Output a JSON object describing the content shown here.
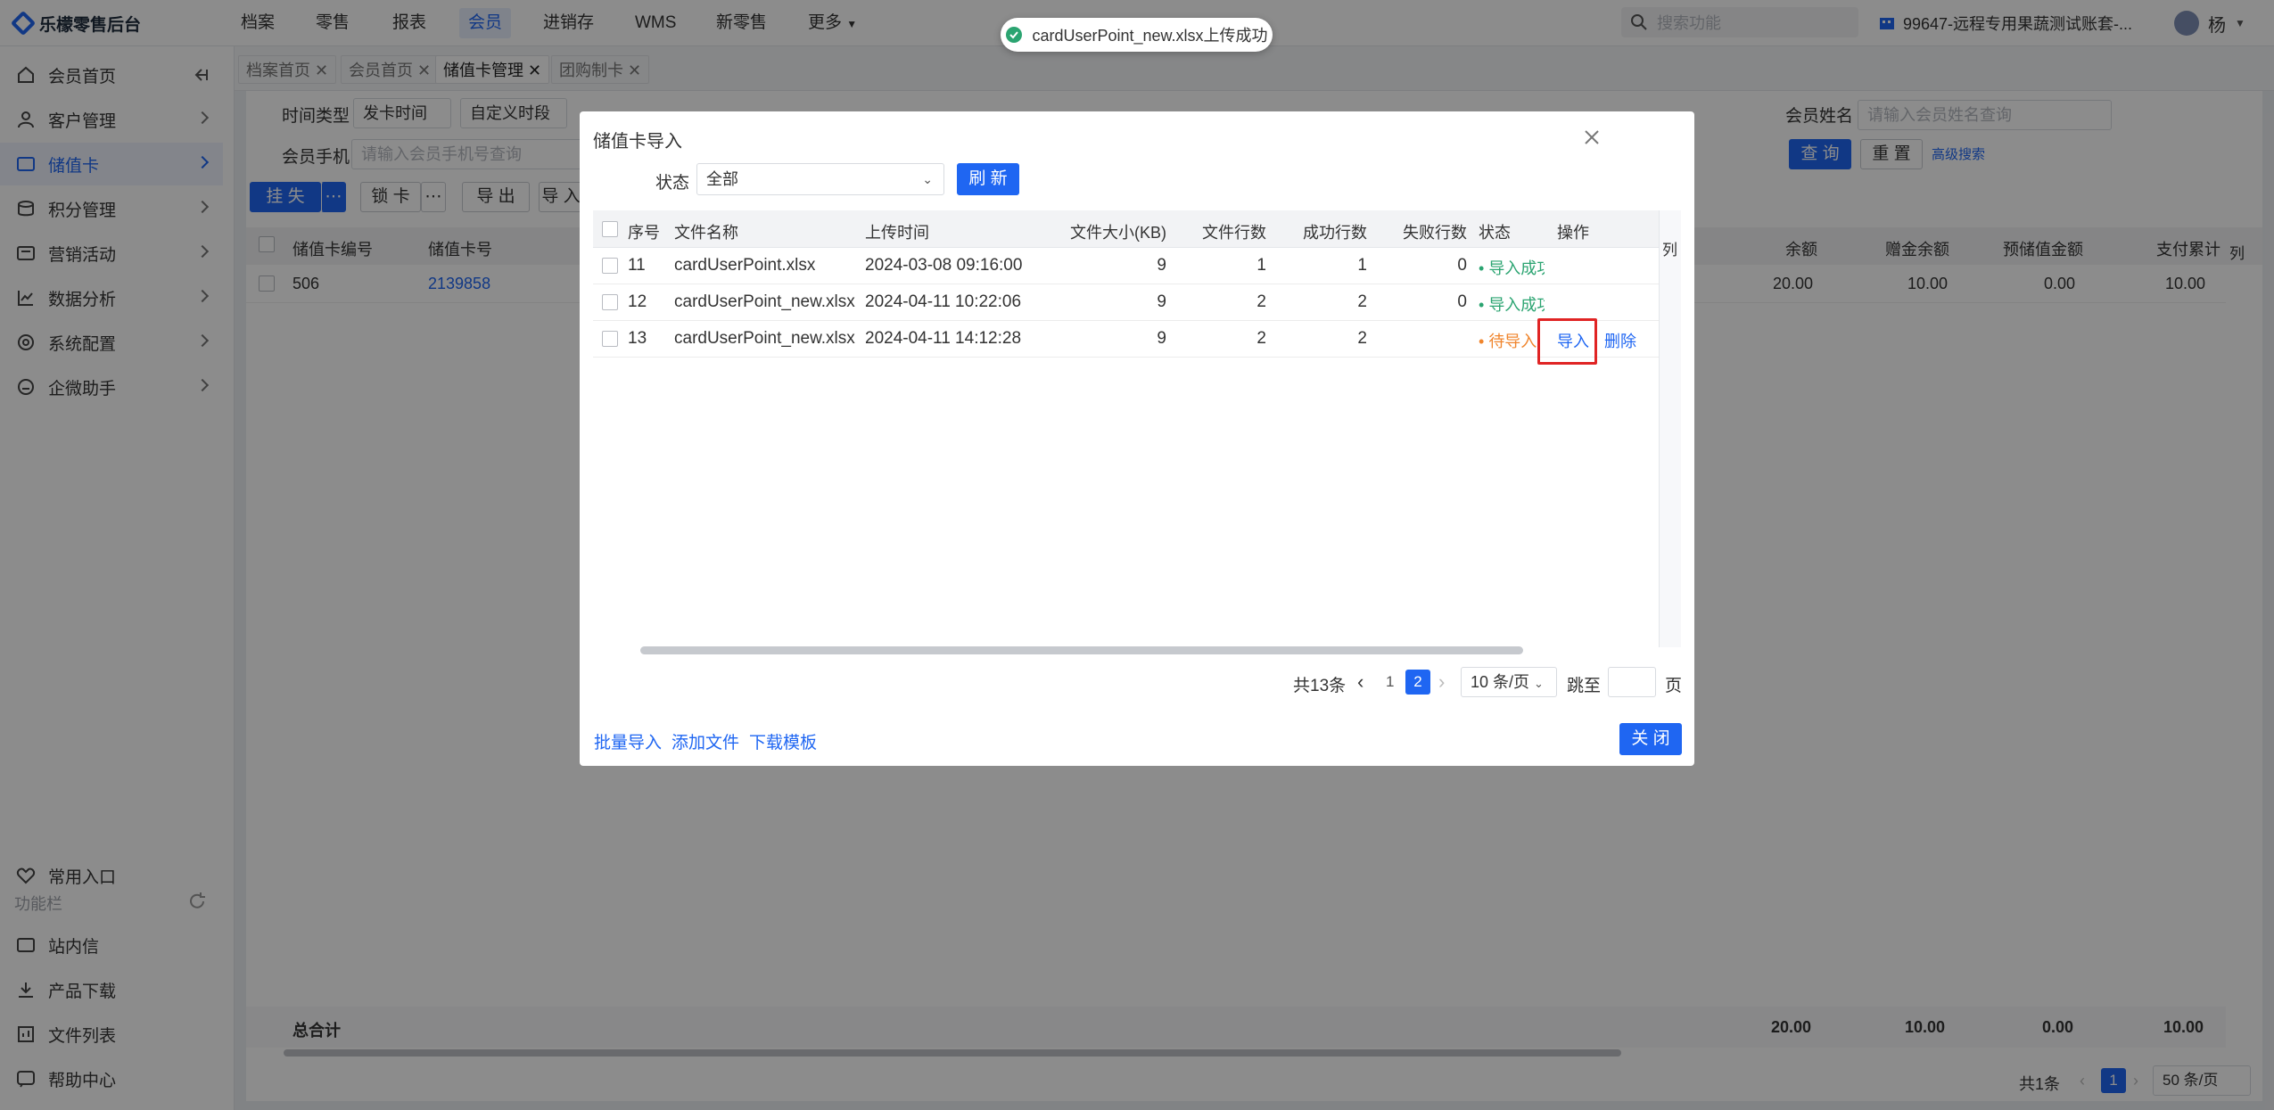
{
  "app": {
    "title": "乐檬零售后台"
  },
  "topnav": {
    "items": [
      {
        "label": "档案"
      },
      {
        "label": "零售"
      },
      {
        "label": "报表"
      },
      {
        "label": "会员"
      },
      {
        "label": "进销存"
      },
      {
        "label": "WMS"
      },
      {
        "label": "新零售"
      },
      {
        "label": "更多"
      }
    ],
    "search_placeholder": "搜索功能",
    "account": "99647-远程专用果蔬测试账套-...",
    "user": "杨"
  },
  "sidebar": {
    "items": [
      {
        "label": "会员首页"
      },
      {
        "label": "客户管理"
      },
      {
        "label": "储值卡"
      },
      {
        "label": "积分管理"
      },
      {
        "label": "营销活动"
      },
      {
        "label": "数据分析"
      },
      {
        "label": "系统配置"
      },
      {
        "label": "企微助手"
      }
    ],
    "bottom": [
      {
        "label": "常用入口"
      },
      {
        "label": "功能栏"
      },
      {
        "label": "站内信"
      },
      {
        "label": "产品下载"
      },
      {
        "label": "文件列表"
      },
      {
        "label": "帮助中心"
      }
    ]
  },
  "page_tabs": [
    {
      "label": "档案首页"
    },
    {
      "label": "会员首页"
    },
    {
      "label": "储值卡管理"
    },
    {
      "label": "团购制卡"
    }
  ],
  "filters": {
    "time_type_label": "时间类型",
    "time_type_value": "发卡时间",
    "time_range_value": "自定义时段",
    "member_name_label": "会员姓名",
    "member_name_placeholder": "请输入会员姓名查询",
    "member_phone_label": "会员手机",
    "member_phone_placeholder": "请输入会员手机号查询",
    "query_btn": "查 询",
    "reset_btn": "重 置",
    "advanced": "高级搜索"
  },
  "toolbar": {
    "report_loss": "挂 失",
    "lock": "锁 卡",
    "export": "导 出",
    "import": "导 入"
  },
  "bg_table": {
    "columns": [
      "储值卡编号",
      "储值卡号",
      "余额",
      "赠金余额",
      "预储值金额",
      "支付累计"
    ],
    "row": {
      "no": "506",
      "card": "2139858",
      "balance": "20.00",
      "gift": "10.00",
      "prestore": "0.00",
      "paid": "10.00"
    },
    "total_label": "总合计",
    "totals": {
      "balance": "20.00",
      "gift": "10.00",
      "prestore": "0.00",
      "paid": "10.00"
    },
    "col_settings": "列",
    "pagination": {
      "total": "共1条",
      "page": "1",
      "page_size": "50 条/页"
    }
  },
  "toast": {
    "text": "cardUserPoint_new.xlsx上传成功"
  },
  "modal": {
    "title": "储值卡导入",
    "status_label": "状态",
    "status_value": "全部",
    "refresh": "刷 新",
    "columns": [
      "序号",
      "文件名称",
      "上传时间",
      "文件大小(KB)",
      "文件行数",
      "成功行数",
      "失败行数",
      "状态",
      "操作"
    ],
    "col_settings": "列",
    "rows": [
      {
        "no": "11",
        "name": "cardUserPoint.xlsx",
        "time": "2024-03-08 09:16:00",
        "size": "9",
        "lines": "1",
        "success": "1",
        "fail": "0",
        "status": "导入成功",
        "status_color": "#2ba471",
        "actions": []
      },
      {
        "no": "12",
        "name": "cardUserPoint_new.xlsx",
        "time": "2024-04-11 10:22:06",
        "size": "9",
        "lines": "2",
        "success": "2",
        "fail": "0",
        "status": "导入成功",
        "status_color": "#2ba471",
        "actions": []
      },
      {
        "no": "13",
        "name": "cardUserPoint_new.xlsx",
        "time": "2024-04-11 14:12:28",
        "size": "9",
        "lines": "2",
        "success": "2",
        "fail": "",
        "status": "待导入",
        "status_color": "#f0852d",
        "actions": [
          "导入",
          "删除"
        ]
      }
    ],
    "pagination": {
      "total": "共13条",
      "pages": [
        "1",
        "2"
      ],
      "current": "2",
      "page_size": "10 条/页",
      "jump_label": "跳至",
      "page_unit": "页"
    },
    "footer": {
      "batch_import": "批量导入",
      "add_file": "添加文件",
      "download_template": "下载模板",
      "close": "关 闭"
    }
  }
}
